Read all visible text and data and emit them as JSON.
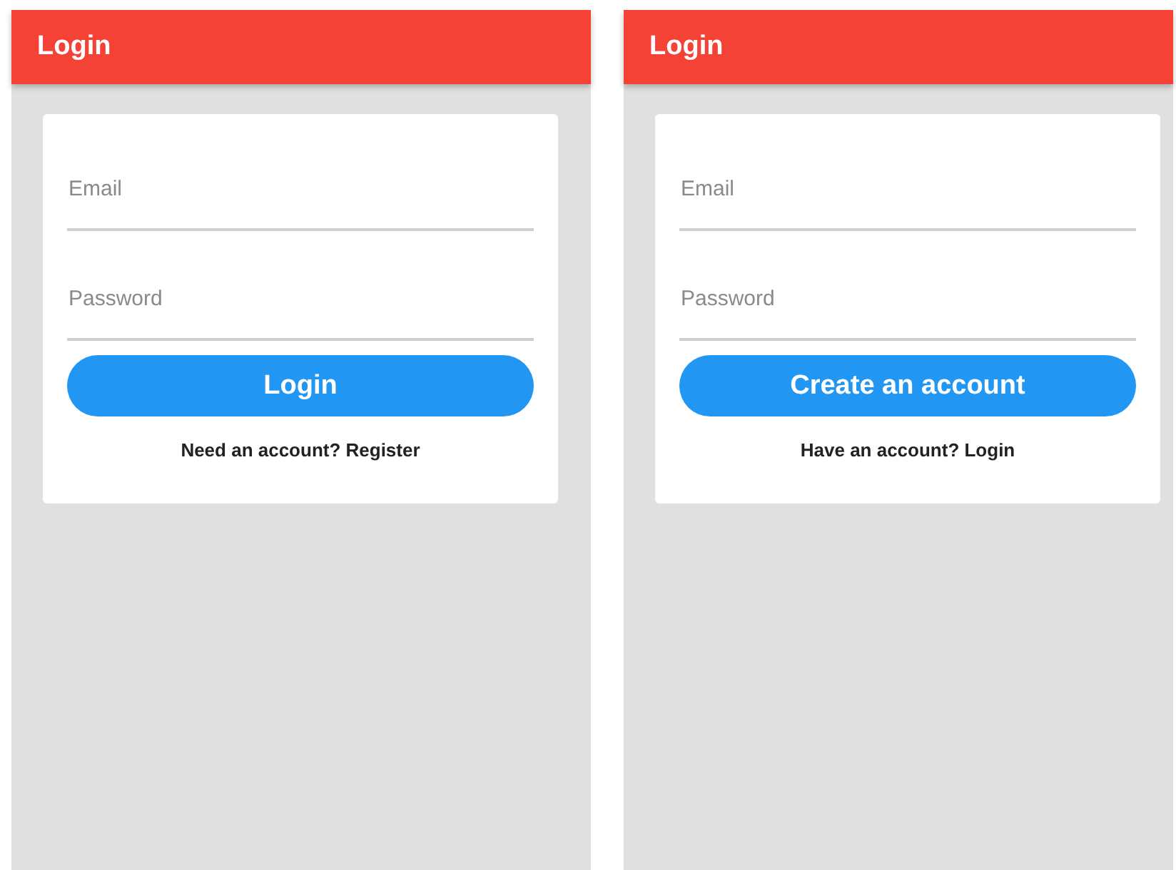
{
  "screens": [
    {
      "title": "Login",
      "email": {
        "placeholder": "Email"
      },
      "password": {
        "placeholder": "Password"
      },
      "button": "Login",
      "footer": "Need an account? Register"
    },
    {
      "title": "Login",
      "email": {
        "placeholder": "Email"
      },
      "password": {
        "placeholder": "Password"
      },
      "button": "Create an account",
      "footer": "Have an account? Login"
    }
  ]
}
